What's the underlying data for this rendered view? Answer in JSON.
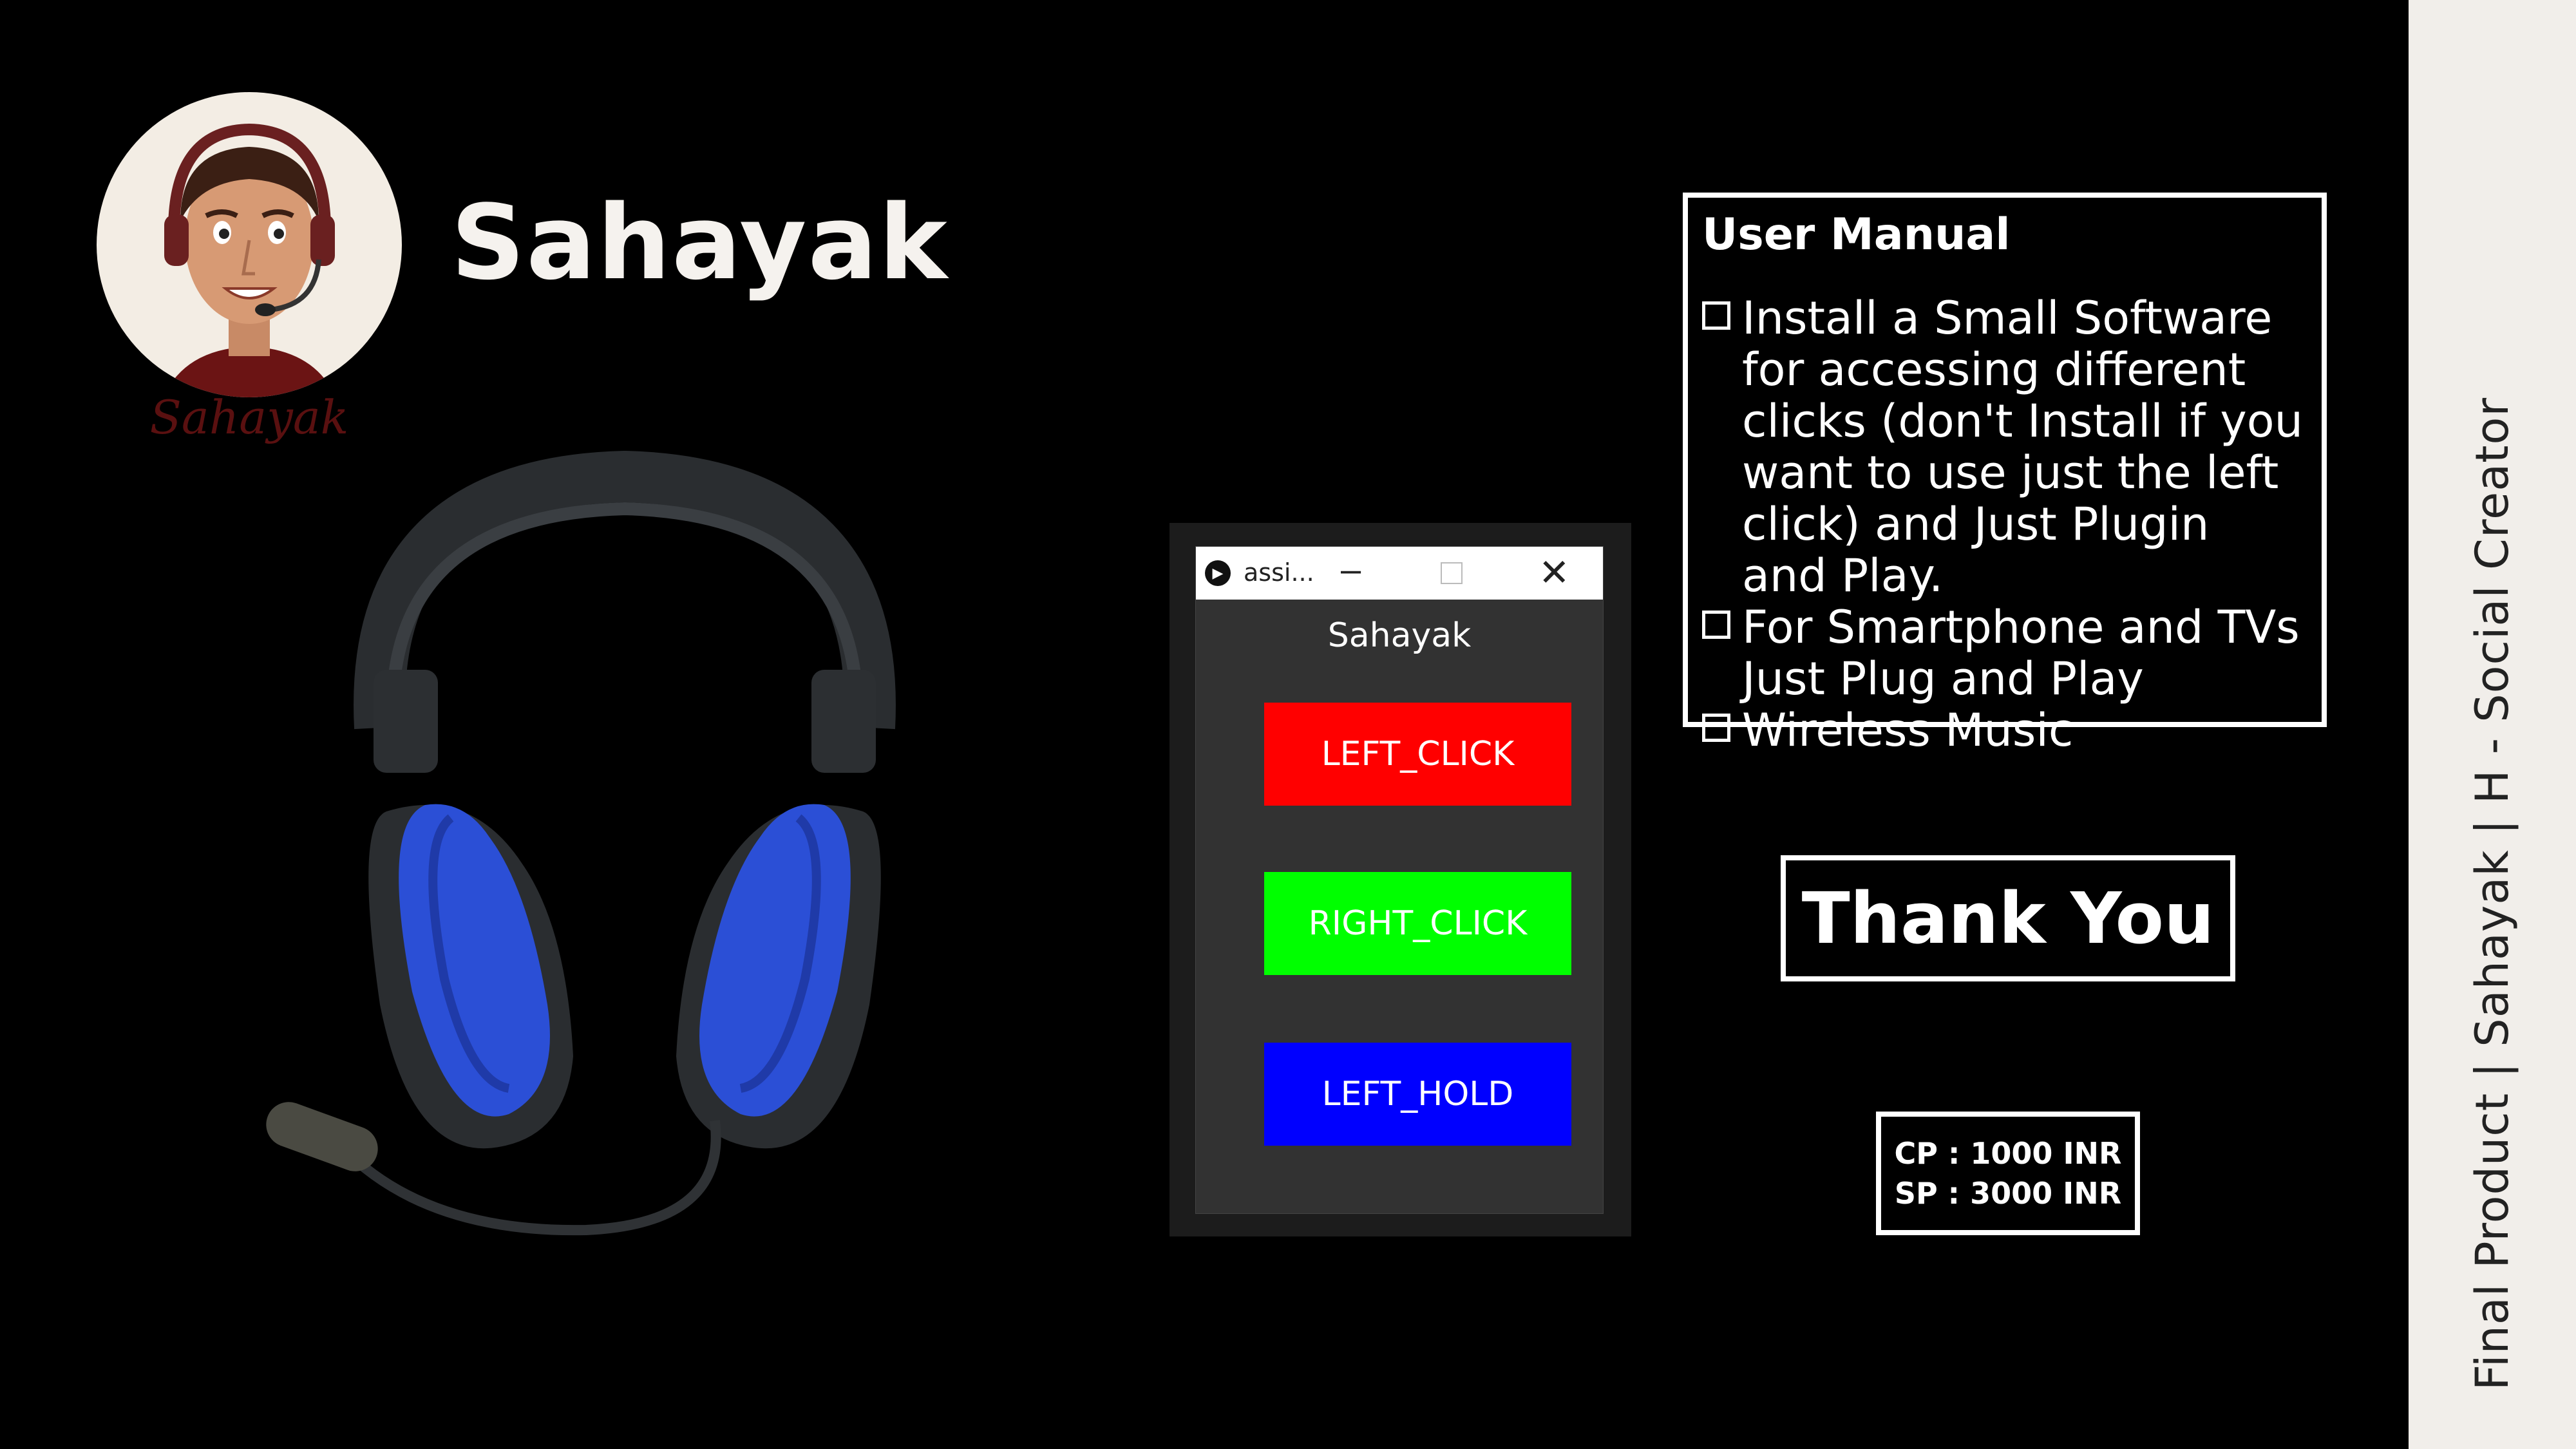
{
  "brand": {
    "name": "Sahayak",
    "logo_caption": "Sahayak"
  },
  "side_caption": "Final Product | Sahayak | H - Social Creator",
  "app_window": {
    "title": "assi...",
    "heading": "Sahayak",
    "buttons": [
      {
        "label": "LEFT_CLICK",
        "color": "#ff0000"
      },
      {
        "label": "RIGHT_CLICK",
        "color": "#00ff00"
      },
      {
        "label": "LEFT_HOLD",
        "color": "#0000ff"
      }
    ]
  },
  "manual": {
    "title": "User Manual",
    "items": [
      "Install a Small Software for accessing different clicks (don't Install if you want to use just the left click) and Just Plugin and Play.",
      "For Smartphone and TVs Just Plug and Play",
      "Wireless Music"
    ]
  },
  "thanks": "Thank You",
  "pricing": {
    "cp": "CP : 1000 INR",
    "sp": "SP : 3000 INR"
  },
  "colors": {
    "background": "#000000",
    "side_band": "#f1eeea",
    "headphone_pad": "#2b4fd6"
  }
}
